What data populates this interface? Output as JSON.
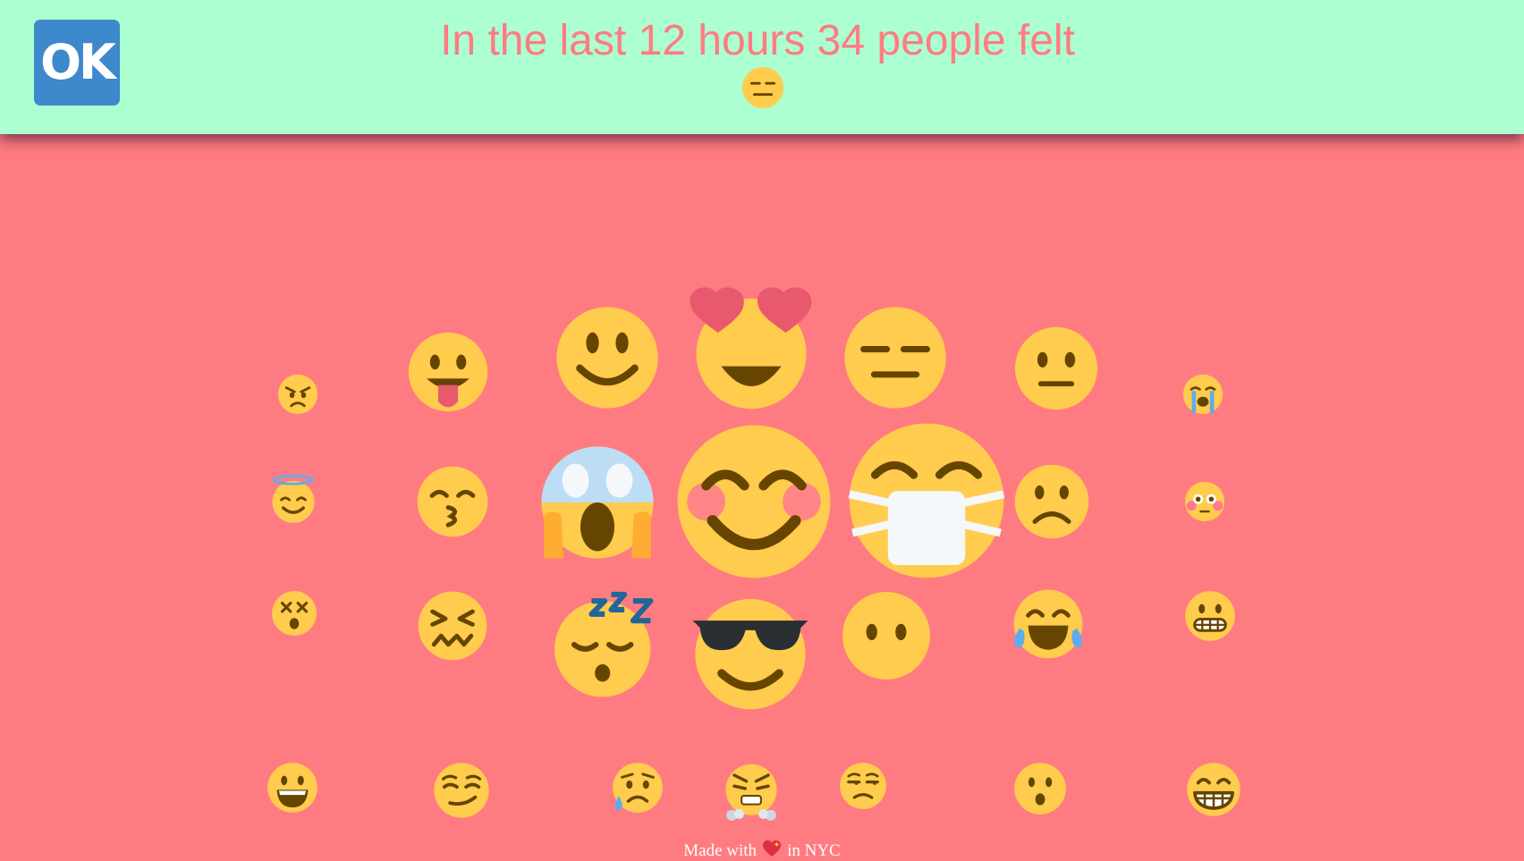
{
  "header": {
    "logo_text": "OK",
    "headline": "In the last 12 hours 34 people felt",
    "current_mood_icon": "expressionless-face-icon"
  },
  "colors": {
    "background": "#ff7b82",
    "header_background": "#acffd0",
    "headline_text": "#ff7b82",
    "logo_background": "#3d89cc",
    "emoji_face": "#ffcc4d",
    "emoji_features": "#664500"
  },
  "emojis": [
    "pouting-face-icon",
    "face-with-tongue-icon",
    "smiling-face-icon",
    "heart-eyes-face-icon",
    "expressionless-face-icon",
    "neutral-face-icon",
    "loudly-crying-face-icon",
    "smiling-face-with-halo-icon",
    "kissing-face-icon",
    "face-screaming-in-fear-icon",
    "smiling-face-with-smiling-eyes-icon",
    "face-with-medical-mask-icon",
    "frowning-face-icon",
    "flushed-face-icon",
    "dizzy-face-icon",
    "confounded-face-icon",
    "sleeping-face-icon",
    "smiling-face-with-sunglasses-icon",
    "face-without-mouth-icon",
    "face-with-tears-of-joy-icon",
    "grimacing-face-icon",
    "grinning-face-icon",
    "smirking-face-icon",
    "sad-but-relieved-face-icon",
    "face-with-steam-from-nose-icon",
    "unamused-face-icon",
    "hushed-face-icon",
    "grinning-face-with-smiling-eyes-icon"
  ],
  "footer": {
    "made_with": "Made with",
    "location": "in NYC",
    "heart_icon": "sparkling-heart-icon"
  }
}
